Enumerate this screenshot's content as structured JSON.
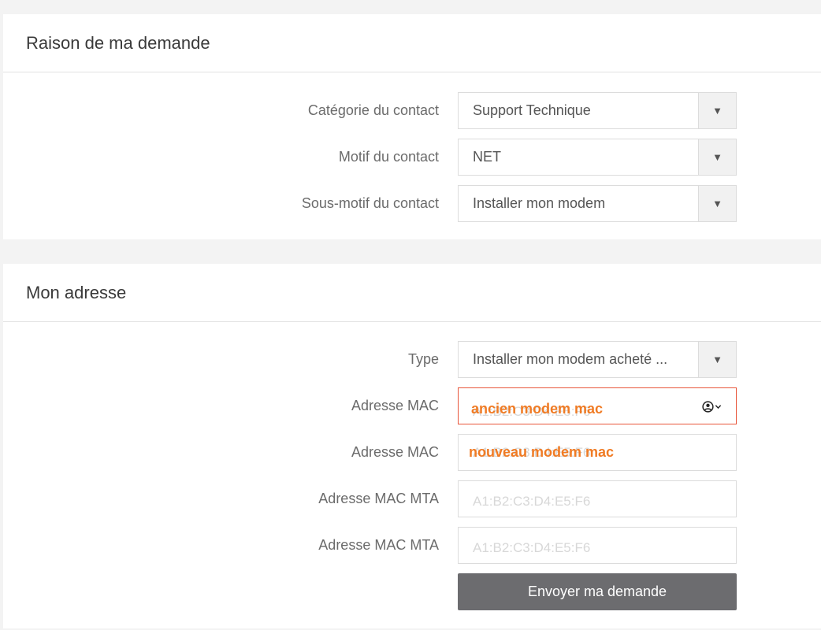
{
  "section_reason": {
    "title": "Raison de ma demande",
    "fields": [
      {
        "label": "Catégorie du contact",
        "value": "Support Technique"
      },
      {
        "label": "Motif du contact",
        "value": "NET"
      },
      {
        "label": "Sous-motif du contact",
        "value": "Installer mon modem"
      }
    ]
  },
  "section_address": {
    "title": "Mon adresse",
    "type": {
      "label": "Type",
      "value": "Installer mon modem acheté ..."
    },
    "mac_old": {
      "label": "Adresse MAC",
      "placeholder": "A1:B2:C3:D4:E5:F6",
      "overlay": "ancien modem mac"
    },
    "mac_new": {
      "label": "Adresse MAC",
      "placeholder": "A1:B2:C3:D4:E5:F6",
      "overlay": "nouveau modem mac"
    },
    "mac_mta_1": {
      "label": "Adresse MAC MTA",
      "placeholder": "A1:B2:C3:D4:E5:F6"
    },
    "mac_mta_2": {
      "label": "Adresse MAC MTA",
      "placeholder": "A1:B2:C3:D4:E5:F6"
    },
    "submit_label": "Envoyer ma demande"
  },
  "icons": {
    "select_arrow": "▼",
    "autofill": "account-circle-icon"
  },
  "colors": {
    "error_border": "#e8553a",
    "overlay_text": "#f07b24",
    "submit_bg": "#6c6c6f"
  }
}
